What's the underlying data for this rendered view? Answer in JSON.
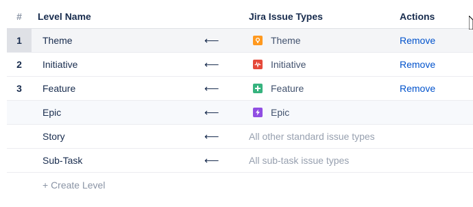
{
  "header": {
    "num": "#",
    "level_name": "Level Name",
    "issue_types": "Jira Issue Types",
    "actions": "Actions"
  },
  "rows": [
    {
      "num": "1",
      "name": "Theme",
      "arrow": "⟵",
      "type_label": "Theme",
      "icon": "lightbulb-icon",
      "icon_color": "#ff991f",
      "action": "Remove"
    },
    {
      "num": "2",
      "name": "Initiative",
      "arrow": "⟵",
      "type_label": "Initiative",
      "icon": "pulse-icon",
      "icon_color": "#ff5630",
      "action": "Remove"
    },
    {
      "num": "3",
      "name": "Feature",
      "arrow": "⟵",
      "type_label": "Feature",
      "icon": "plus-icon",
      "icon_color": "#36b37e",
      "action": "Remove"
    },
    {
      "num": "",
      "name": "Epic",
      "arrow": "⟵",
      "type_label": "Epic",
      "icon": "lightning-icon",
      "icon_color": "#6554c0",
      "action": ""
    },
    {
      "num": "",
      "name": "Story",
      "arrow": "⟵",
      "type_label": "All other standard issue types",
      "icon": "",
      "action": ""
    },
    {
      "num": "",
      "name": "Sub-Task",
      "arrow": "⟵",
      "type_label": "All sub-task issue types",
      "icon": "",
      "action": ""
    }
  ],
  "create_level": "+ Create Level",
  "colors": {
    "link": "#0052cc",
    "text": "#172b4d",
    "muted": "#97a0af"
  }
}
